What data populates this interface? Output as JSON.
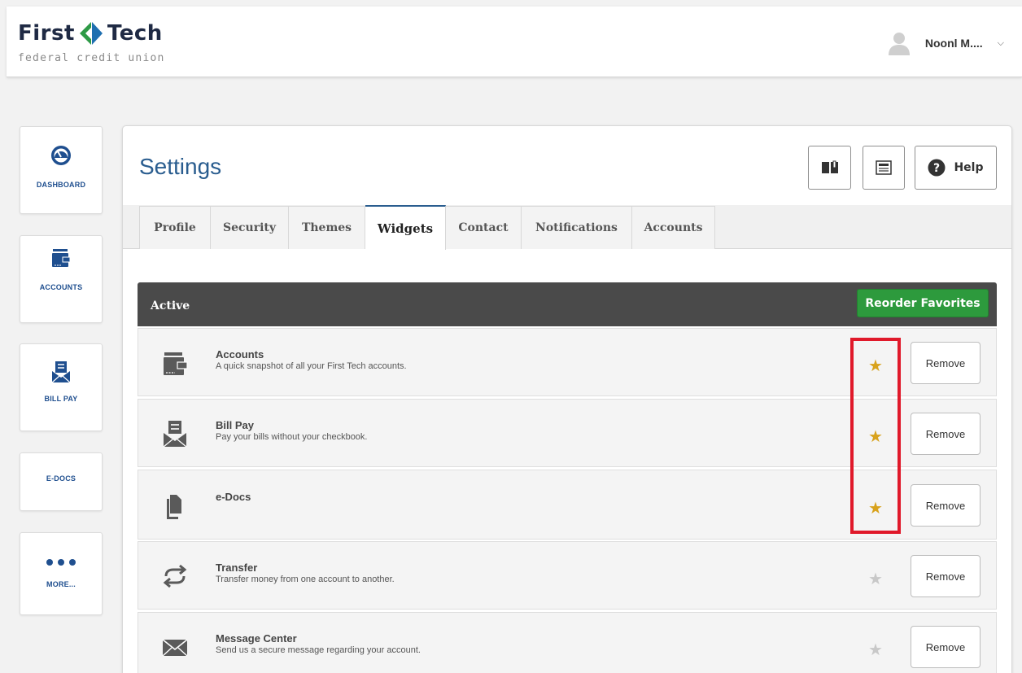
{
  "brand": {
    "name_left": "First",
    "name_right": "Tech",
    "subtitle": "federal credit union"
  },
  "user": {
    "name": "Noonl M....",
    "caret": "⌄"
  },
  "nav": [
    {
      "label": "DASHBOARD",
      "icon": "dashboard-gauge-icon"
    },
    {
      "label": "ACCOUNTS",
      "icon": "wallet-icon"
    },
    {
      "label": "BILL PAY",
      "icon": "bill-envelope-icon"
    },
    {
      "label": "E-DOCS",
      "icon": ""
    },
    {
      "label": "MORE...",
      "icon": "more-dots-icon"
    }
  ],
  "page": {
    "title": "Settings",
    "help_label": "Help"
  },
  "tabs": [
    "Profile",
    "Security",
    "Themes",
    "Widgets",
    "Contact",
    "Notifications",
    "Accounts"
  ],
  "active_tab": "Widgets",
  "section": {
    "title": "Active",
    "reorder_label": "Reorder Favorites"
  },
  "widgets": [
    {
      "title": "Accounts",
      "description": "A quick snapshot of all your First Tech accounts.",
      "favorite": true,
      "remove_label": "Remove",
      "icon": "wallet-icon"
    },
    {
      "title": "Bill Pay",
      "description": "Pay your bills without your checkbook.",
      "favorite": true,
      "remove_label": "Remove",
      "icon": "bill-envelope-icon"
    },
    {
      "title": "e-Docs",
      "description": "",
      "favorite": true,
      "remove_label": "Remove",
      "icon": "documents-icon"
    },
    {
      "title": "Transfer",
      "description": "Transfer money from one account to another.",
      "favorite": false,
      "remove_label": "Remove",
      "icon": "transfer-arrows-icon"
    },
    {
      "title": "Message Center",
      "description": "Send us a secure message regarding your account.",
      "favorite": false,
      "remove_label": "Remove",
      "icon": "envelope-icon"
    }
  ],
  "colors": {
    "brand_blue": "#2a5d8f",
    "favorite_star": "#d8a21c",
    "reorder_green": "#2d9a3d",
    "highlight_red": "#e0192a"
  }
}
